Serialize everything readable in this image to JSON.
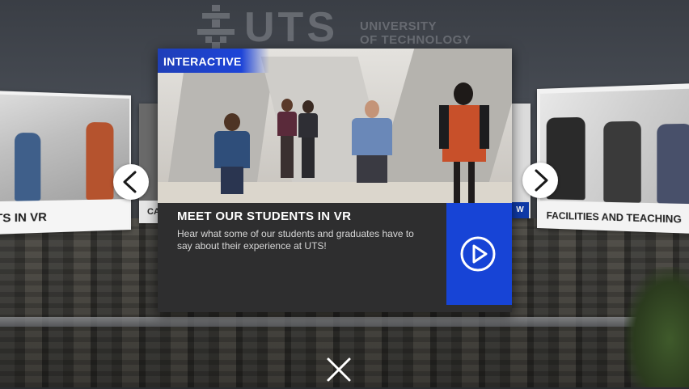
{
  "brand": {
    "logo_text": "UTS",
    "logo_subtitle_line1": "UNIVERSITY",
    "logo_subtitle_line2": "OF TECHNOLOGY"
  },
  "left_card": {
    "caption": "TS IN VR"
  },
  "left_card_partial": {
    "caption": "CA"
  },
  "right_card_partial": {
    "tag": "W"
  },
  "right_card": {
    "caption": "FACILITIES AND TEACHING"
  },
  "main_card": {
    "badge": "INTERACTIVE",
    "title": "MEET OUR STUDENTS IN VR",
    "description": "Hear what some of our students and graduates have to say about their experience at UTS!",
    "play_icon": "play-icon"
  },
  "nav": {
    "prev_icon": "chevron-left-icon",
    "next_icon": "chevron-right-icon",
    "close_icon": "close-icon"
  },
  "colors": {
    "accent_blue": "#1744d6",
    "card_dark": "#2e2e2f",
    "text_white": "#ffffff"
  }
}
